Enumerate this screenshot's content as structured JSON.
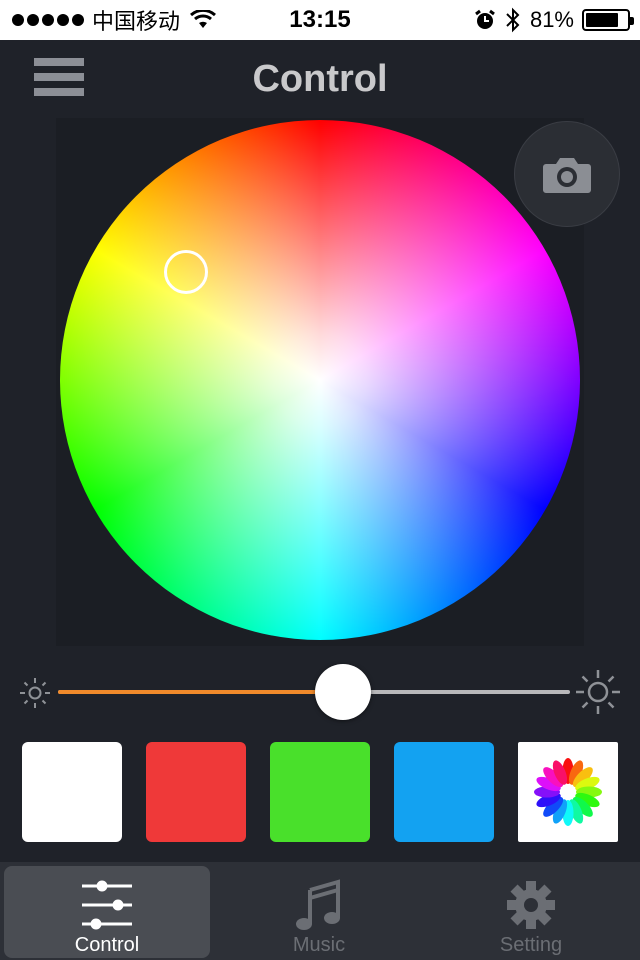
{
  "status_bar": {
    "carrier": "中国移动",
    "time": "13:15",
    "battery": "81%",
    "battery_level": 0.81,
    "icons": [
      "signal-dots",
      "wifi-icon",
      "alarm-icon",
      "bluetooth-icon",
      "battery-icon"
    ]
  },
  "header": {
    "title": "Control",
    "menu_icon": "hamburger-menu-icon"
  },
  "color_picker": {
    "selected_color": "#fff87a",
    "camera_icon": "camera-icon"
  },
  "brightness": {
    "value_fraction": 0.55,
    "accent": "#f08a2b",
    "min_icon": "sun-small-icon",
    "max_icon": "sun-large-icon"
  },
  "presets": [
    {
      "name": "white",
      "color": "#ffffff"
    },
    {
      "name": "red",
      "color": "#ef3939"
    },
    {
      "name": "green",
      "color": "#49e02b"
    },
    {
      "name": "blue",
      "color": "#13a2f1"
    },
    {
      "name": "rainbow",
      "icon": "rainbow-flower-icon"
    }
  ],
  "tabs": [
    {
      "label": "Control",
      "icon": "sliders-icon",
      "active": true
    },
    {
      "label": "Music",
      "icon": "music-note-icon",
      "active": false
    },
    {
      "label": "Setting",
      "icon": "gear-icon",
      "active": false
    }
  ]
}
